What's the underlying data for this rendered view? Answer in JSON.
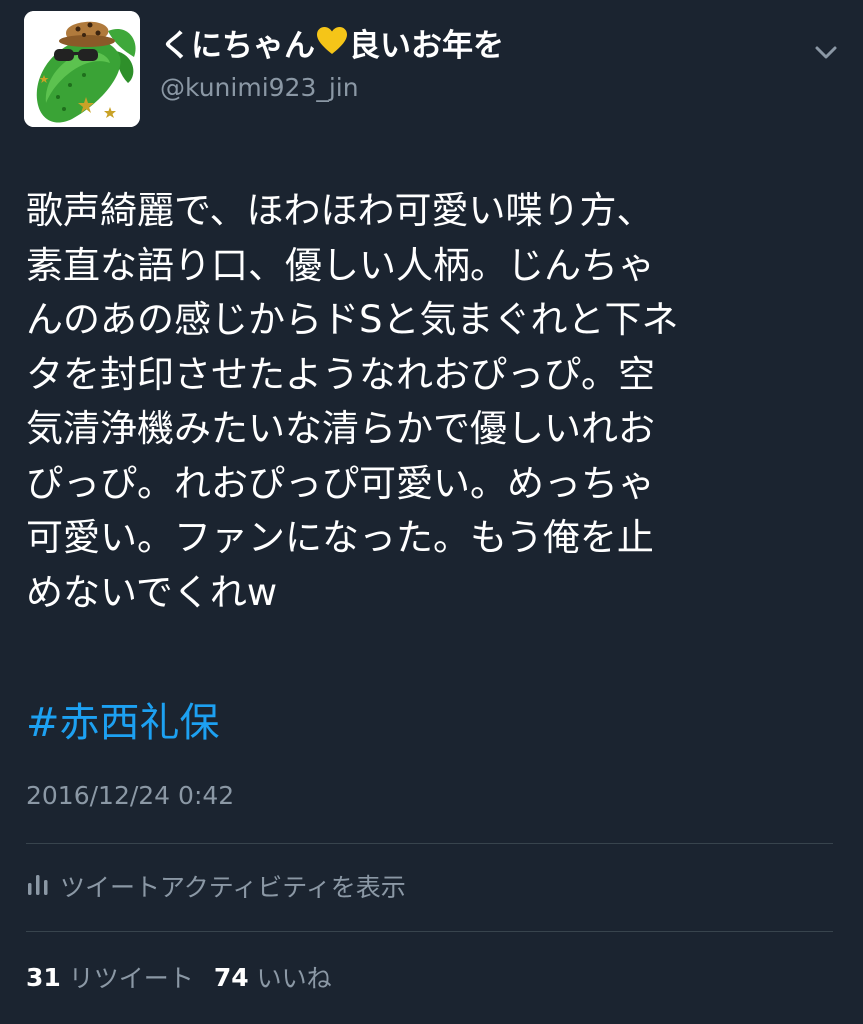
{
  "tweet": {
    "author": {
      "display_name_before": "くにちゃん",
      "display_name_after": "良いお年を",
      "heart_color": "#f5c518",
      "handle": "@kunimi923_jin",
      "avatar_icon": "cucumber-avatar-icon"
    },
    "menu_icon": "chevron-down-icon",
    "body_lines": [
      "歌声綺麗で、ほわほわ可愛い喋り方、",
      "素直な語り口、優しい人柄。じんちゃ",
      "んのあの感じからドSと気まぐれと下ネ",
      "タを封印させたようなれおぴっぴ。空",
      "気清浄機みたいな清らかで優しいれお",
      "ぴっぴ。れおぴっぴ可愛い。めっちゃ",
      "可愛い。ファンになった。もう俺を止",
      "めないでくれw"
    ],
    "hashtag": "#赤西礼保",
    "timestamp": "2016/12/24 0:42",
    "activity_label": "ツイートアクティビティを表示",
    "activity_icon": "bar-chart-icon",
    "retweets": {
      "count": "31",
      "label": "リツイート"
    },
    "likes": {
      "count": "74",
      "label": "いいね"
    }
  },
  "colors": {
    "background": "#1b2430",
    "text": "#ffffff",
    "secondary_text": "#8b98a5",
    "link": "#1da1f2",
    "divider": "#38444d"
  }
}
